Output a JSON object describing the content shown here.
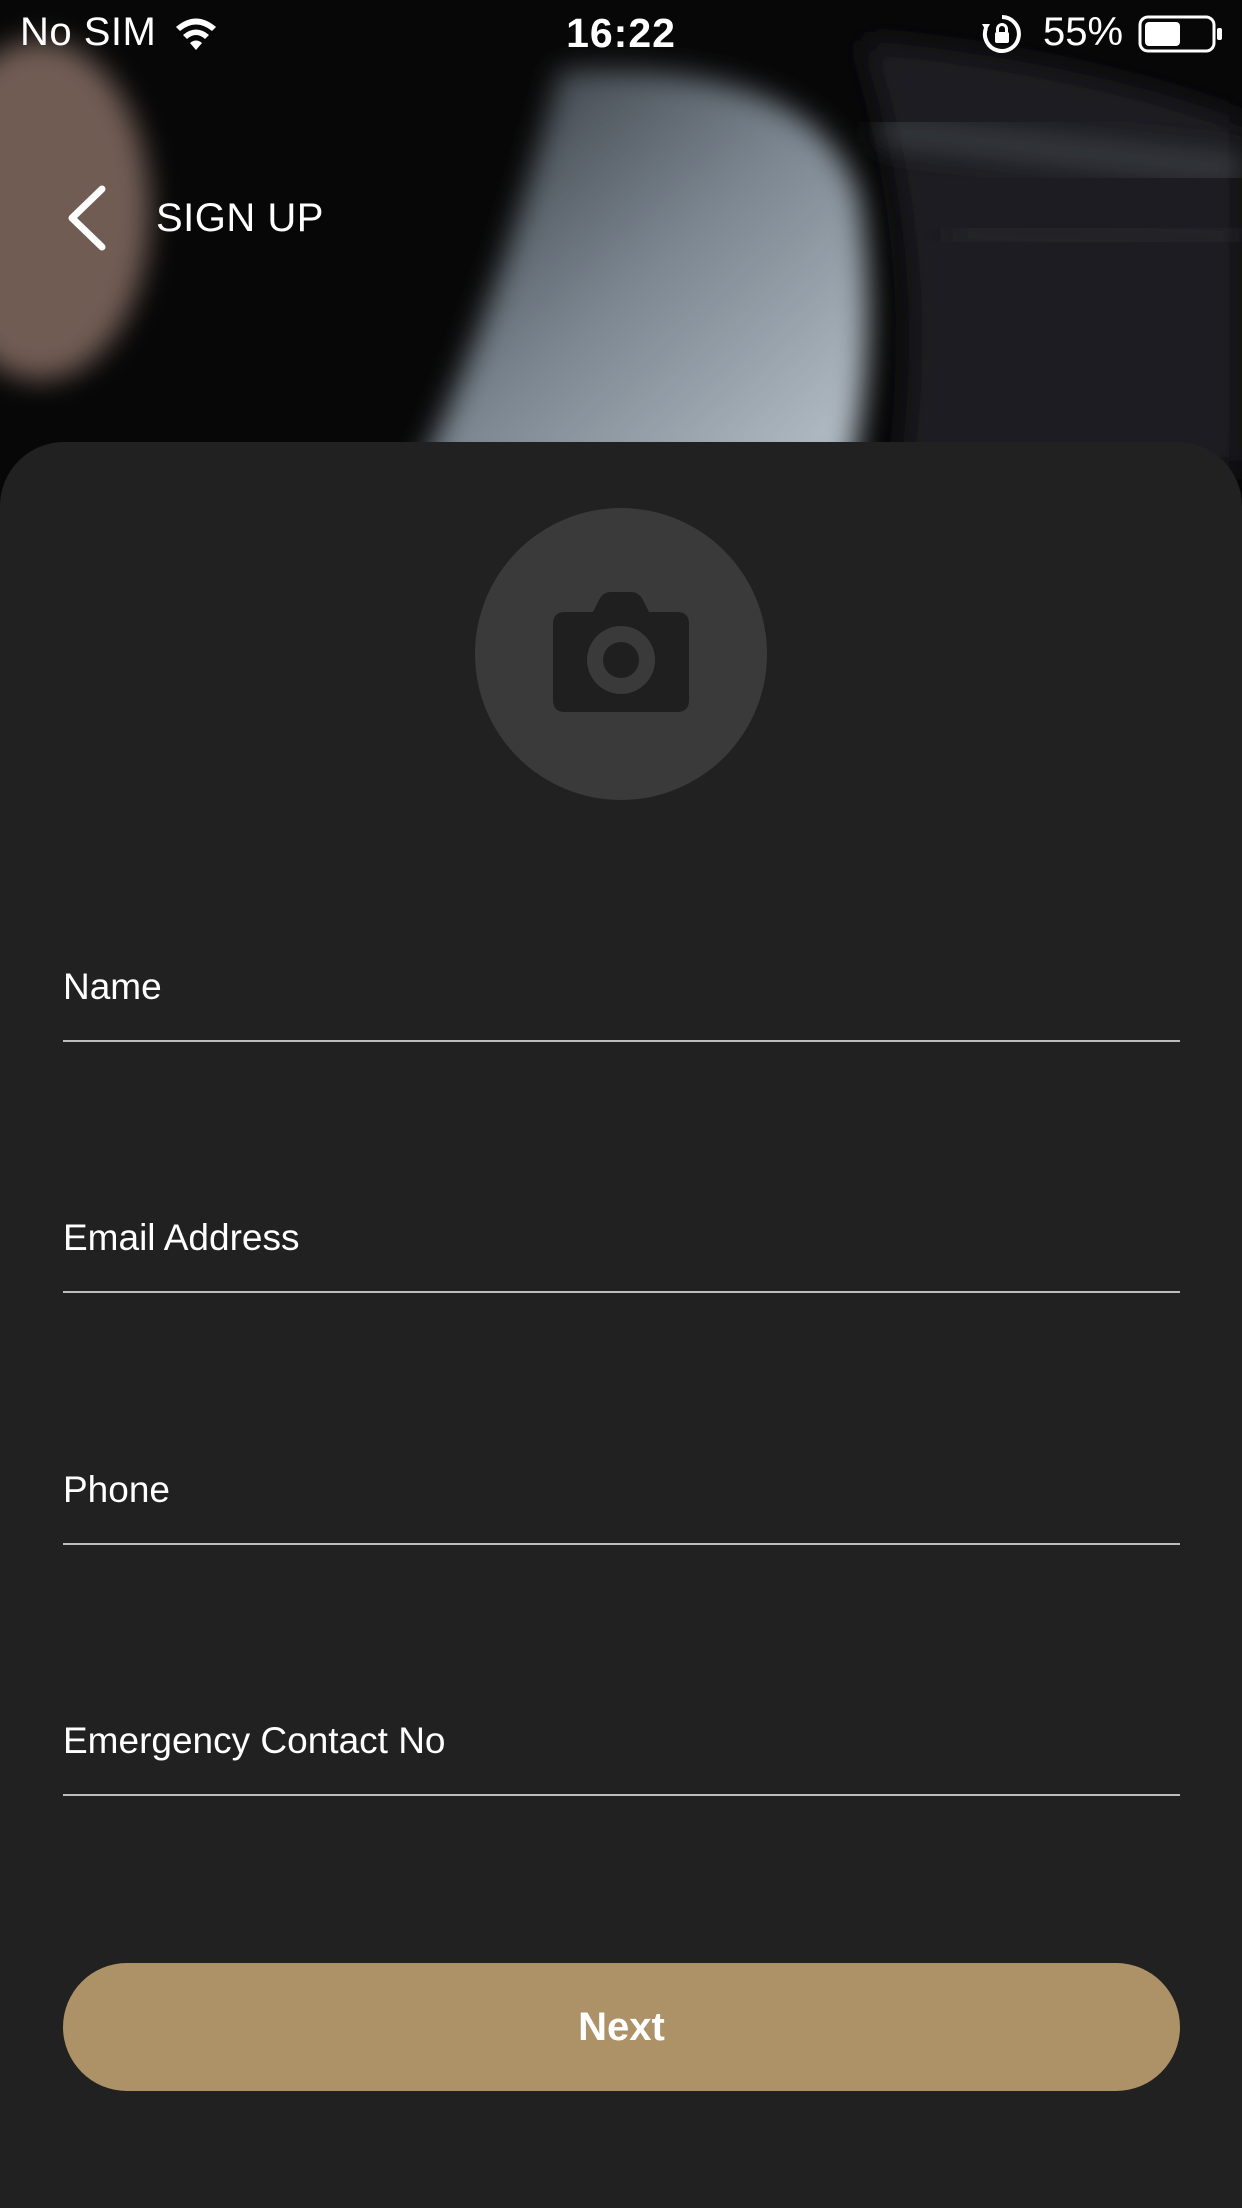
{
  "status_bar": {
    "carrier": "No SIM",
    "time": "16:22",
    "battery_percent": "55%",
    "battery_level": 0.55
  },
  "header": {
    "title": "SIGN UP"
  },
  "form": {
    "fields": [
      {
        "label": "Name",
        "value": ""
      },
      {
        "label": "Email Address",
        "value": ""
      },
      {
        "label": "Phone",
        "value": ""
      },
      {
        "label": "Emergency Contact No",
        "value": ""
      }
    ]
  },
  "actions": {
    "next_label": "Next"
  },
  "colors": {
    "background": "#212121",
    "avatar_circle": "#3a3a3a",
    "camera_icon": "#1f1f1f",
    "field_underline": "#bdbdbd",
    "accent": "#ad9167",
    "text": "#ffffff"
  },
  "icons": {
    "back": "chevron-left-icon",
    "avatar": "camera-icon",
    "wifi": "wifi-icon",
    "rotation_lock": "rotation-lock-icon",
    "battery": "battery-icon"
  }
}
